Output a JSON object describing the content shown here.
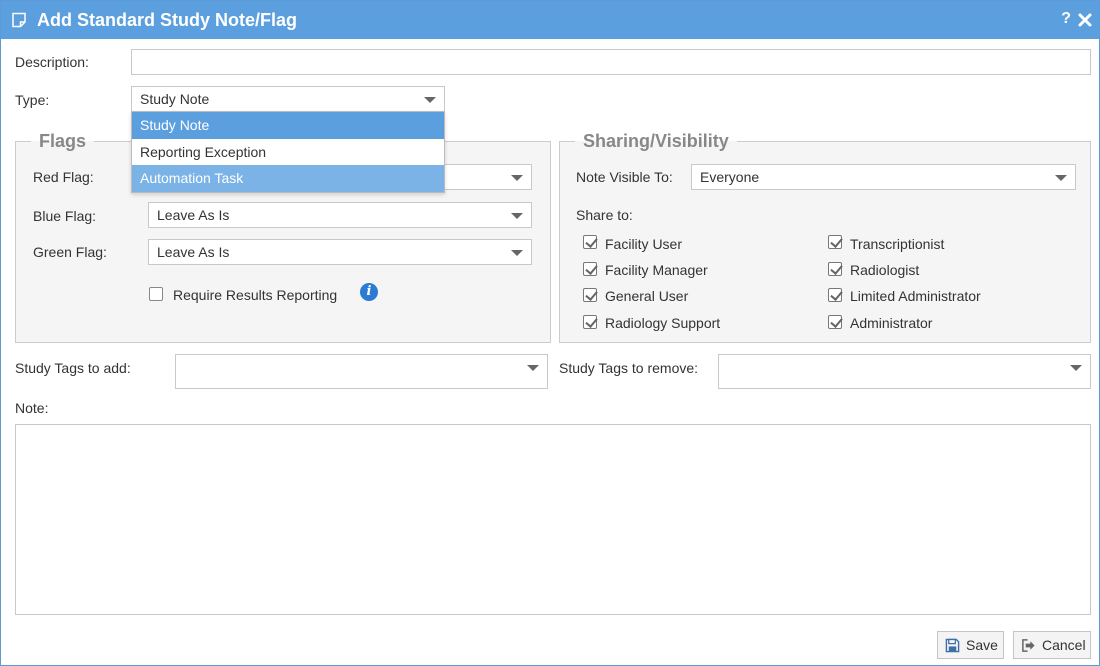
{
  "dialog": {
    "title": "Add Standard Study Note/Flag",
    "help_glyph": "?",
    "accent_color": "#5b9fde"
  },
  "form": {
    "description_label": "Description:",
    "description_value": "",
    "type_label": "Type:",
    "type_value": "Study Note",
    "type_options": [
      "Study Note",
      "Reporting Exception",
      "Automation Task"
    ]
  },
  "flags": {
    "legend": "Flags",
    "red_label": "Red Flag:",
    "blue_label": "Blue Flag:",
    "blue_value": "Leave As Is",
    "green_label": "Green Flag:",
    "green_value": "Leave As Is",
    "require_results_label": "Require Results Reporting",
    "require_results_checked": false
  },
  "sharing": {
    "legend": "Sharing/Visibility",
    "visible_to_label": "Note Visible To:",
    "visible_to_value": "Everyone",
    "share_to_label": "Share to:",
    "roles": [
      {
        "label": "Facility User",
        "checked": true
      },
      {
        "label": "Transcriptionist",
        "checked": true
      },
      {
        "label": "Facility Manager",
        "checked": true
      },
      {
        "label": "Radiologist",
        "checked": true
      },
      {
        "label": "General User",
        "checked": true
      },
      {
        "label": "Limited Administrator",
        "checked": true
      },
      {
        "label": "Radiology Support",
        "checked": true
      },
      {
        "label": "Administrator",
        "checked": true
      }
    ]
  },
  "tags": {
    "add_label": "Study Tags to add:",
    "remove_label": "Study Tags to remove:"
  },
  "note": {
    "label": "Note:",
    "value": ""
  },
  "buttons": {
    "save_label": "Save",
    "cancel_label": "Cancel"
  }
}
